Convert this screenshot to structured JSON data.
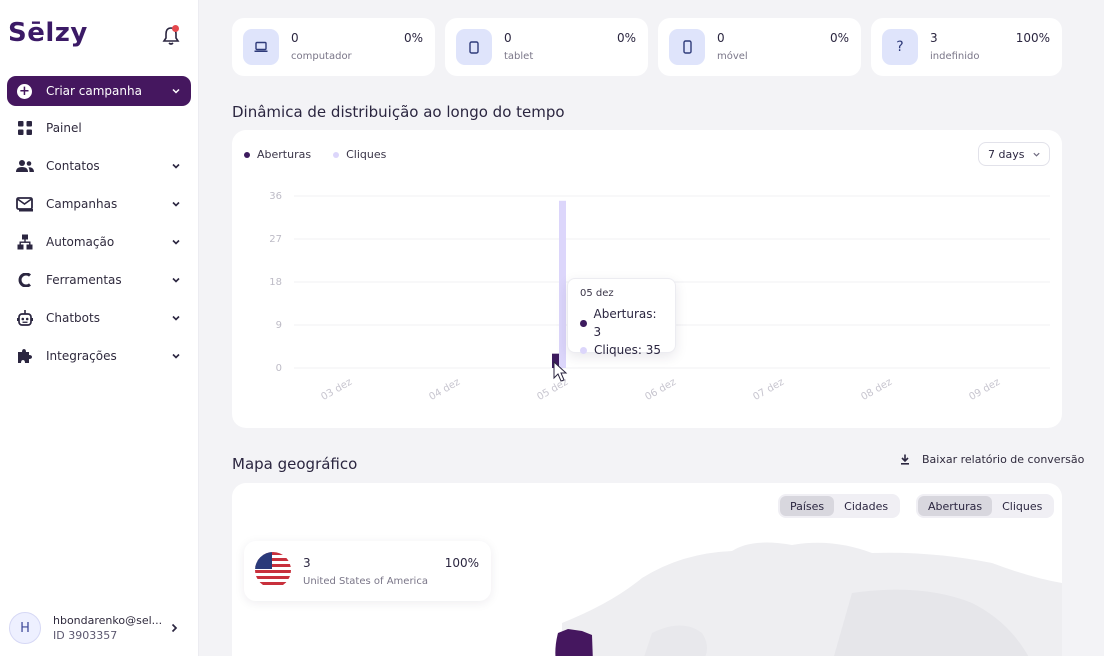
{
  "brand": {
    "logo": "Sēlzy"
  },
  "sidebar": {
    "cta_label": "Criar campanha",
    "items": [
      {
        "label": "Painel",
        "icon": "grid-icon",
        "has_chevron": false
      },
      {
        "label": "Contatos",
        "icon": "users-icon",
        "has_chevron": true
      },
      {
        "label": "Campanhas",
        "icon": "envelope-icon",
        "has_chevron": true
      },
      {
        "label": "Automação",
        "icon": "sitemap-icon",
        "has_chevron": true
      },
      {
        "label": "Ferramentas",
        "icon": "tools-icon",
        "has_chevron": true
      },
      {
        "label": "Chatbots",
        "icon": "robot-icon",
        "has_chevron": true
      },
      {
        "label": "Integrações",
        "icon": "puzzle-icon",
        "has_chevron": true
      }
    ]
  },
  "user": {
    "initial": "H",
    "email": "hbondarenko@sel...",
    "id": "ID 3903357"
  },
  "devices": [
    {
      "value": "0",
      "label": "computador",
      "percent": "0%",
      "icon": "laptop-icon"
    },
    {
      "value": "0",
      "label": "tablet",
      "percent": "0%",
      "icon": "tablet-icon"
    },
    {
      "value": "0",
      "label": "móvel",
      "percent": "0%",
      "icon": "phone-icon"
    },
    {
      "value": "3",
      "label": "indefinido",
      "percent": "100%",
      "icon": "question-icon"
    }
  ],
  "dynamics": {
    "title": "Dinâmica de distribuição ao longo do tempo",
    "range": "7 days",
    "tooltip": {
      "date": "05 dez",
      "aberturas": "Aberturas: 3",
      "cliques": "Cliques: 35"
    }
  },
  "chart_data": {
    "type": "bar",
    "categories": [
      "03 dez",
      "04 dez",
      "05 dez",
      "06 dez",
      "07 dez",
      "08 dez",
      "09 dez"
    ],
    "series": [
      {
        "name": "Aberturas",
        "values": [
          0,
          0,
          3,
          0,
          0,
          0,
          0
        ],
        "color": "#3d1b5e"
      },
      {
        "name": "Cliques",
        "values": [
          0,
          0,
          35,
          0,
          0,
          0,
          0
        ],
        "color": "#dcd6fb"
      }
    ],
    "yticks": [
      "36",
      "27",
      "18",
      "9",
      "0"
    ],
    "ylim": [
      0,
      36
    ],
    "grid": true,
    "legend": "top-left"
  },
  "geo": {
    "title": "Mapa geográfico",
    "download_label": "Baixar relatório de conversão",
    "scope_options": [
      "Países",
      "Cidades"
    ],
    "metric_options": [
      "Aberturas",
      "Cliques"
    ],
    "country": {
      "value": "3",
      "name": "United States of America",
      "percent": "100%"
    }
  },
  "colors": {
    "brand": "#45175f",
    "bar_opens": "#3d1b5e",
    "bar_clicks": "#dcd6fb",
    "icon_bg": "#dfe4fb"
  }
}
